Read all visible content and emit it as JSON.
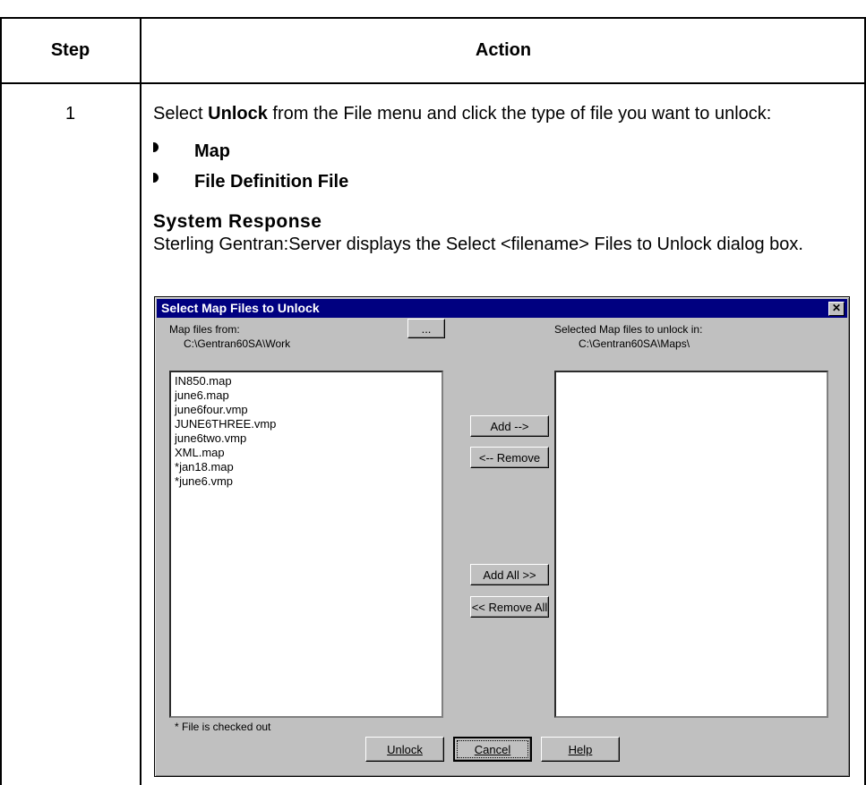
{
  "table": {
    "header_step": "Step",
    "header_action": "Action",
    "step_number": "1",
    "intro_pre": "Select ",
    "intro_bold": "Unlock",
    "intro_post": " from the File menu and click the type of file you want to unlock:",
    "bullets": [
      "Map",
      "File Definition File"
    ],
    "system_response_heading": "System Response",
    "system_response_text": "Sterling Gentran:Server displays the Select <filename> Files to Unlock dialog box."
  },
  "dialog": {
    "title": "Select Map Files to Unlock",
    "close_glyph": "✕",
    "map_files_from_label": "Map files from:",
    "map_files_from_path": "C:\\Gentran60SA\\Work",
    "browse_label": "...",
    "selected_label": "Selected Map files to unlock in:",
    "selected_path": "C:\\Gentran60SA\\Maps\\",
    "available_files": [
      "IN850.map",
      "june6.map",
      "june6four.vmp",
      "JUNE6THREE.vmp",
      "june6two.vmp",
      "XML.map",
      "jan18.map",
      "june6.vmp"
    ],
    "checked_out_marks": [
      "",
      "",
      "",
      "",
      "",
      "",
      "*",
      "*"
    ],
    "add_label": "Add -->",
    "remove_label": "<-- Remove",
    "add_all_label": "Add All >>",
    "remove_all_label": "<< Remove All",
    "footnote": "* File is checked out",
    "unlock_label": "Unlock",
    "cancel_label": "Cancel",
    "help_label": "Help"
  }
}
